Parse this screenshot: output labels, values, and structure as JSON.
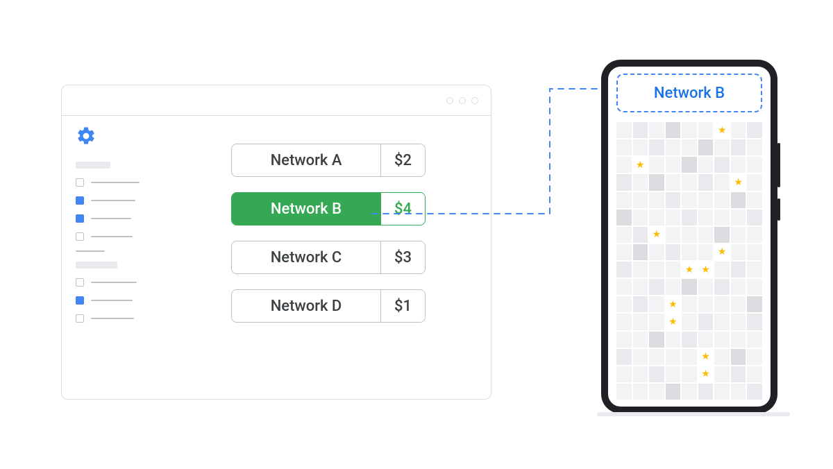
{
  "networks": [
    {
      "name": "Network A",
      "price": "$2",
      "selected": false
    },
    {
      "name": "Network B",
      "price": "$4",
      "selected": true
    },
    {
      "name": "Network C",
      "price": "$3",
      "selected": false
    },
    {
      "name": "Network D",
      "price": "$1",
      "selected": false
    }
  ],
  "phone": {
    "banner_label": "Network B"
  },
  "colors": {
    "accent_blue": "#4285f4",
    "accent_green": "#34a853",
    "star_yellow": "#fbbc04"
  },
  "sidebar": {
    "items": [
      {
        "checked": false,
        "len": 70
      },
      {
        "checked": true,
        "len": 64
      },
      {
        "checked": true,
        "len": 58
      },
      {
        "checked": false,
        "len": 60
      }
    ],
    "items2": [
      {
        "checked": false,
        "len": 66
      },
      {
        "checked": true,
        "len": 60
      },
      {
        "checked": false,
        "len": 62
      }
    ]
  },
  "grid": {
    "cols": 9,
    "rows": 16,
    "stars": [
      [
        0,
        6
      ],
      [
        2,
        1
      ],
      [
        3,
        7
      ],
      [
        6,
        2
      ],
      [
        7,
        6
      ],
      [
        8,
        4
      ],
      [
        8,
        5
      ],
      [
        10,
        3
      ],
      [
        11,
        3
      ],
      [
        13,
        5
      ],
      [
        14,
        5
      ]
    ],
    "dark": [
      [
        0,
        3
      ],
      [
        1,
        5
      ],
      [
        2,
        4
      ],
      [
        3,
        2
      ],
      [
        4,
        7
      ],
      [
        5,
        0
      ],
      [
        6,
        6
      ],
      [
        7,
        1
      ],
      [
        9,
        4
      ],
      [
        10,
        8
      ],
      [
        12,
        2
      ],
      [
        13,
        7
      ],
      [
        15,
        3
      ]
    ],
    "mid": [
      [
        0,
        1
      ],
      [
        0,
        8
      ],
      [
        1,
        2
      ],
      [
        1,
        7
      ],
      [
        2,
        6
      ],
      [
        3,
        0
      ],
      [
        3,
        5
      ],
      [
        4,
        3
      ],
      [
        5,
        4
      ],
      [
        5,
        8
      ],
      [
        6,
        1
      ],
      [
        7,
        3
      ],
      [
        8,
        0
      ],
      [
        8,
        7
      ],
      [
        9,
        2
      ],
      [
        9,
        6
      ],
      [
        10,
        1
      ],
      [
        11,
        5
      ],
      [
        11,
        8
      ],
      [
        12,
        4
      ],
      [
        13,
        0
      ],
      [
        14,
        2
      ],
      [
        14,
        7
      ],
      [
        15,
        5
      ],
      [
        15,
        8
      ]
    ]
  }
}
